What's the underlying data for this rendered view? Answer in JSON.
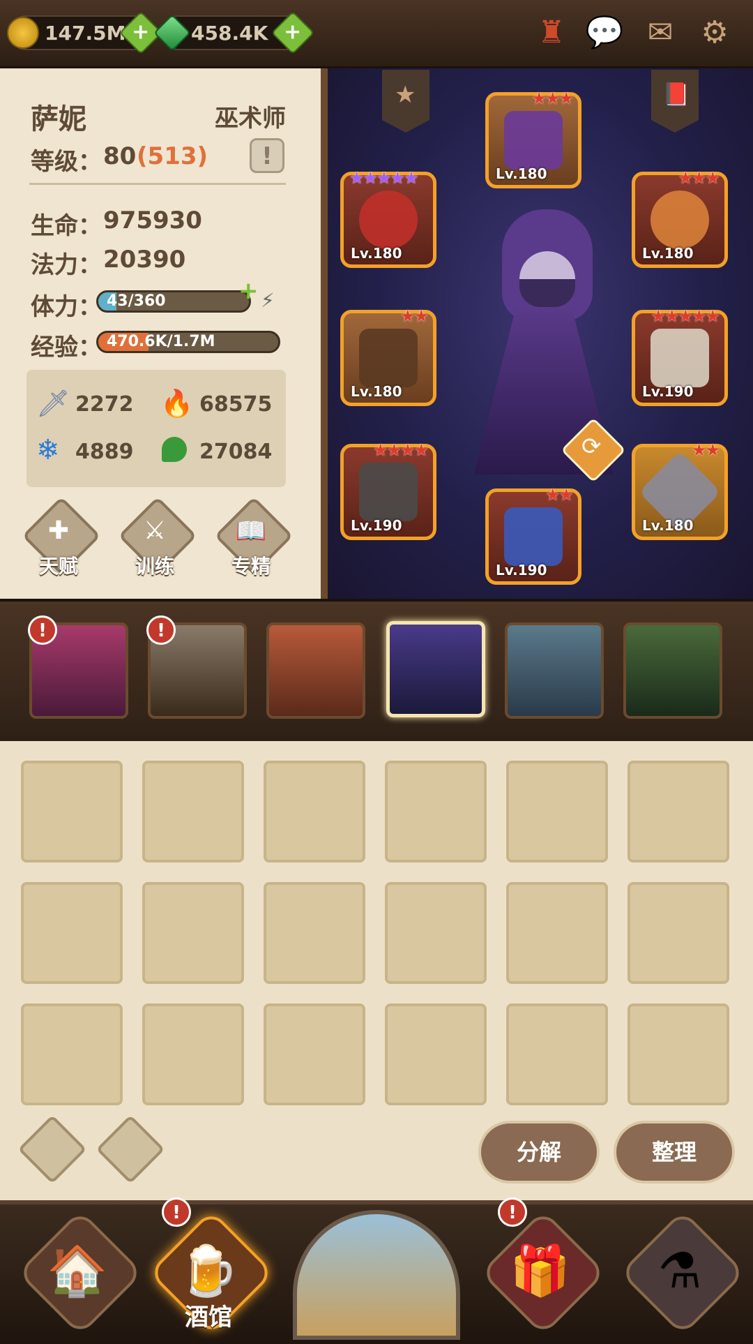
{
  "currencies": {
    "gold": {
      "value": "147.5M",
      "plus": "+"
    },
    "gems": {
      "value": "458.4K",
      "plus": "+"
    }
  },
  "top_icons": [
    "horn-icon",
    "chat-icon",
    "mail-icon",
    "settings-icon"
  ],
  "hero": {
    "name": "萨妮",
    "class": "巫术师",
    "level_label": "等级：",
    "level": "80",
    "level_extra": "(513)",
    "hp_label": "生命：",
    "hp": "975930",
    "mana_label": "法力：",
    "mana": "20390",
    "stamina_label": "体力：",
    "stamina": "43/360",
    "stamina_fraction": 0.12,
    "exp_label": "经验：",
    "exp": "470.6K/1.7M",
    "exp_fraction": 0.28
  },
  "stats": {
    "attack": "2272",
    "fire": "68575",
    "frost": "4889",
    "nature": "27084"
  },
  "skill_buttons": [
    "天赋",
    "训练",
    "专精"
  ],
  "equipment": [
    {
      "slot": "hat",
      "level": "Lv.180",
      "stars": "★★★",
      "rarity": "red"
    },
    {
      "slot": "amulet",
      "level": "Lv.180",
      "stars": "★★★★★",
      "rarity": "purple"
    },
    {
      "slot": "ring",
      "level": "Lv.180",
      "stars": "★★★",
      "rarity": "red"
    },
    {
      "slot": "gloves",
      "level": "Lv.180",
      "stars": "★★",
      "rarity": "brown"
    },
    {
      "slot": "cape",
      "level": "Lv.190",
      "stars": "★★★★★",
      "rarity": "red"
    },
    {
      "slot": "sword",
      "level": "Lv.190",
      "stars": "★★★★",
      "rarity": "red"
    },
    {
      "slot": "boots",
      "level": "Lv.190",
      "stars": "★★",
      "rarity": "red"
    },
    {
      "slot": "shield",
      "level": "Lv.180",
      "stars": "★★",
      "rarity": "gold"
    }
  ],
  "heroes": [
    {
      "name": "hero-1",
      "alert": "!"
    },
    {
      "name": "hero-2",
      "alert": "!"
    },
    {
      "name": "hero-3",
      "alert": ""
    },
    {
      "name": "hero-4",
      "alert": ""
    },
    {
      "name": "hero-5",
      "alert": ""
    },
    {
      "name": "hero-6",
      "alert": ""
    }
  ],
  "inventory": {
    "decompose": "分解",
    "sort": "整理"
  },
  "nav": {
    "tavern": "酒馆",
    "alert": "!"
  }
}
